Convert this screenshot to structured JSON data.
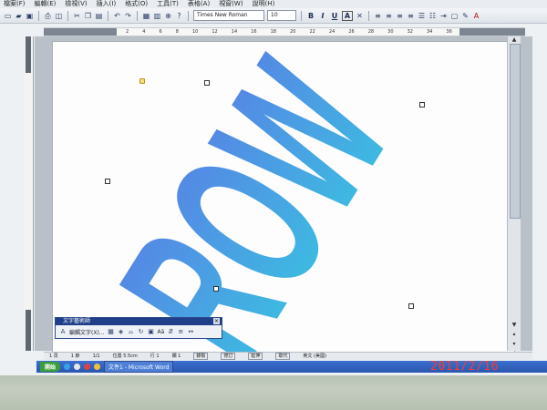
{
  "menu": [
    "檔案(F)",
    "編輯(E)",
    "檢視(V)",
    "插入(I)",
    "格式(O)",
    "工具(T)",
    "表格(A)",
    "視窗(W)",
    "說明(H)"
  ],
  "toolbar": {
    "font": "Times New Roman",
    "size": "10",
    "bold": "B",
    "italic": "I",
    "underline": "U",
    "font_color_letter": "A"
  },
  "ruler": [
    "2",
    "4",
    "6",
    "8",
    "10",
    "12",
    "14",
    "16",
    "18",
    "20",
    "22",
    "24",
    "26",
    "28",
    "30",
    "32",
    "34",
    "36"
  ],
  "wordart": {
    "text": "ROW",
    "color_top": "#5b7be6",
    "color_bottom": "#37c7e0"
  },
  "wordart_toolbar": {
    "title": "文字藝術師",
    "edit_label": "編輯文字(X)...",
    "letter_label": "Aā",
    "close": "×"
  },
  "status": {
    "page": "1 頁",
    "section": "1 節",
    "page_of": "1/1",
    "position": "位置 5.5cm",
    "line": "行 1",
    "col": "欄 1",
    "rec": "錄製",
    "mode": "修訂",
    "ext": "延伸",
    "ovr": "取代",
    "lang": "英文 (美國)"
  },
  "taskbar": {
    "start": "開始",
    "doc": "文件1 - Microsoft Word"
  },
  "timestamp": "2011/2/16"
}
